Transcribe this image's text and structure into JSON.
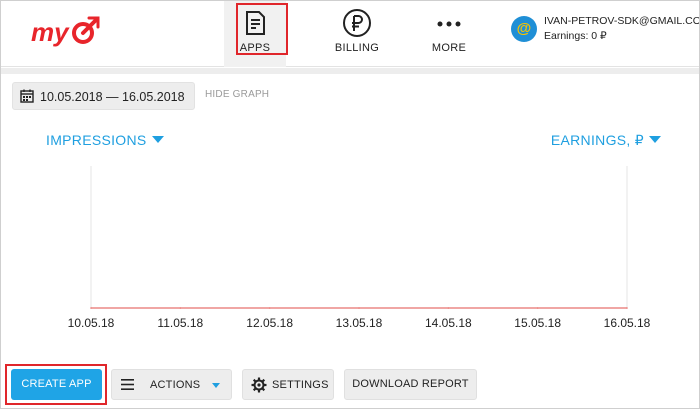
{
  "header": {
    "logo_text": "my",
    "nav": [
      {
        "label": "APPS",
        "icon": "document-icon"
      },
      {
        "label": "BILLING",
        "icon": "ruble-icon"
      },
      {
        "label": "MORE",
        "icon": "more-icon"
      }
    ],
    "user": {
      "avatar": "@",
      "email": "IVAN-PETROV-SDK@GMAIL.COM",
      "earnings": "Earnings: 0 ₽"
    }
  },
  "toolbar": {
    "date_range": "10.05.2018 — 16.05.2018",
    "hide_graph": "HIDE GRAPH"
  },
  "metrics": {
    "left": "IMPRESSIONS",
    "right": "EARNINGS, ₽"
  },
  "chart_data": {
    "type": "line",
    "x": [
      "10.05.18",
      "11.05.18",
      "12.05.18",
      "13.05.18",
      "14.05.18",
      "15.05.18",
      "16.05.18"
    ],
    "series": [
      {
        "values": [
          0,
          0,
          0,
          0,
          0,
          0,
          0
        ],
        "color": "#e8716d"
      }
    ],
    "grid": true,
    "vertical_gridlines": true
  },
  "actions": {
    "create_app": "CREATE APP",
    "actions": "ACTIONS",
    "settings": "SETTINGS",
    "download_report": "DOWNLOAD REPORT"
  },
  "colors": {
    "accent": "#1fa4e6",
    "link": "#1f9fe0",
    "brand": "#e8252b",
    "highlight": "#e0262b"
  }
}
